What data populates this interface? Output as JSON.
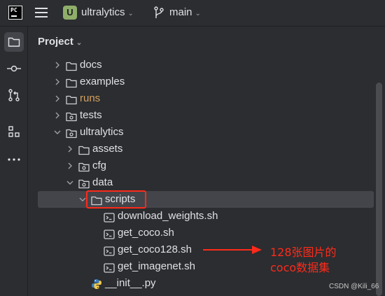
{
  "titlebar": {
    "app_logo_text": "PC",
    "project_badge": "U",
    "project_name": "ultralytics",
    "branch_name": "main"
  },
  "toolwindow": {
    "title": "Project"
  },
  "tree": [
    {
      "label": "docs",
      "type": "folder",
      "level": 1,
      "expanded": false
    },
    {
      "label": "examples",
      "type": "folder",
      "level": 1,
      "expanded": false
    },
    {
      "label": "runs",
      "type": "folder",
      "level": 1,
      "expanded": false,
      "color": "#d6a160"
    },
    {
      "label": "tests",
      "type": "package",
      "level": 1,
      "expanded": false
    },
    {
      "label": "ultralytics",
      "type": "package",
      "level": 1,
      "expanded": true
    },
    {
      "label": "assets",
      "type": "folder",
      "level": 2,
      "expanded": false
    },
    {
      "label": "cfg",
      "type": "package",
      "level": 2,
      "expanded": false
    },
    {
      "label": "data",
      "type": "package",
      "level": 2,
      "expanded": true
    },
    {
      "label": "scripts",
      "type": "folder",
      "level": 3,
      "expanded": true,
      "selected": true
    },
    {
      "label": "download_weights.sh",
      "type": "shell",
      "level": 4
    },
    {
      "label": "get_coco.sh",
      "type": "shell",
      "level": 4
    },
    {
      "label": "get_coco128.sh",
      "type": "shell",
      "level": 4
    },
    {
      "label": "get_imagenet.sh",
      "type": "shell",
      "level": 4
    },
    {
      "label": "__init__.py",
      "type": "python",
      "level": 3
    }
  ],
  "annotation": {
    "line1": "128张图片的",
    "line2": "coco数据集",
    "color": "#ff2a1a"
  },
  "watermark": "CSDN @Kili_66"
}
